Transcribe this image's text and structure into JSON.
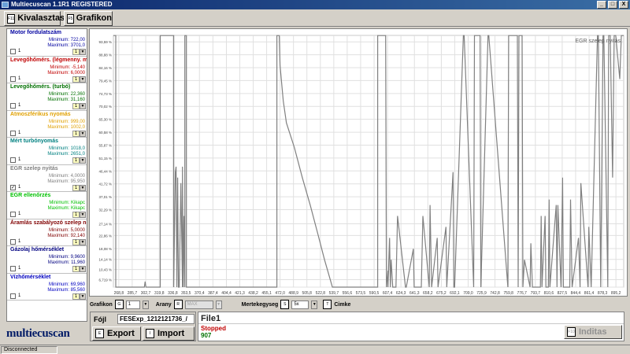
{
  "window": {
    "title": "Multiecuscan 1.1R1 REGISTERED",
    "minimize": "_",
    "maximize": "□",
    "close": "X"
  },
  "tabs": [
    {
      "key": "F11",
      "label": "Kivalasztas"
    },
    {
      "key": "F5",
      "label": "Grafikon"
    }
  ],
  "channels": [
    {
      "name": "Motor fordulatszám",
      "min": "Minimum: 722,00",
      "max": "Maximum: 3701,0",
      "color": "#0000a0",
      "checked": false,
      "index": "1",
      "select": "1"
    },
    {
      "name": "Levegőhőmérs. (légmenny. m",
      "min": "Minimum: -5,140",
      "max": "Maximum: 6,0000",
      "color": "#c00000",
      "checked": false,
      "index": "1",
      "select": "1"
    },
    {
      "name": "Levegőhőmérs. (turbó)",
      "min": "Minimum: 22,360",
      "max": "Maximum: 31,160",
      "color": "#007000",
      "checked": false,
      "index": "1",
      "select": "1"
    },
    {
      "name": "Atmoszférikus nyomás",
      "min": "Minimum: 999,00",
      "max": "Maximum: 1002,0",
      "color": "#e0a000",
      "checked": false,
      "index": "1",
      "select": "1"
    },
    {
      "name": "Mért turbónyomás",
      "min": "Minimum: 1018,0",
      "max": "Maximum: 2651,0",
      "color": "#008080",
      "checked": false,
      "index": "1",
      "select": "1"
    },
    {
      "name": "EGR szelep nyitás",
      "min": "Minimum: 4,0000",
      "max": "Maximum: 95,950",
      "color": "#808080",
      "checked": true,
      "index": "1",
      "select": "1"
    },
    {
      "name": "EGR ellenőrzés",
      "min": "Minimum: Kikapc",
      "max": "Maximum: Kikapc",
      "color": "#00c000",
      "checked": false,
      "index": "1",
      "select": "1"
    },
    {
      "name": "Áramlás szabályozó szelep n",
      "min": "Minimum: 5,0000",
      "max": "Maximum: 92,140",
      "color": "#800000",
      "checked": false,
      "index": "1",
      "select": "1"
    },
    {
      "name": "Gázolaj hőmérséklet",
      "min": "Minimum: 9,9600",
      "max": "Maximum: 11,960",
      "color": "#000080",
      "checked": false,
      "index": "1",
      "select": "1"
    },
    {
      "name": "Vízhőmérséklet",
      "min": "Minimum: 69,960",
      "max": "Maximum: 85,560",
      "color": "#0000c0",
      "checked": false,
      "index": "1",
      "select": "1"
    }
  ],
  "logo": "multiecuscan",
  "controls": {
    "grafikon_label": "Grafikon",
    "grafikon_key": "G",
    "grafikon_value": "1",
    "arany_label": "Arany",
    "arany_key": "R",
    "arany_value": "MAX",
    "mertekegyseg_label": "Mertekegyseg",
    "mertekegyseg_key": "S",
    "mertekegyseg_value": "5x",
    "cimke_key": "T",
    "cimke_label": "Cimke"
  },
  "file": {
    "label": "Fójl",
    "select_value": "FESExp_1212121736_/"
  },
  "buttons": {
    "export_key": "E",
    "export": "Export",
    "import_key": "I",
    "import": "Import",
    "inditas_key": "F10",
    "inditas": "Inditas"
  },
  "filepanel": {
    "name": "File1",
    "status": "Stopped",
    "count": "907"
  },
  "statusbar": {
    "connection": "Disconnected"
  },
  "chart_data": {
    "type": "line",
    "title": "EGR szelep nyitás",
    "series_color": "#808080",
    "ylim": [
      4.0,
      95.95
    ],
    "yticks": [
      4.0,
      6.719,
      10.43,
      14.14,
      18.08,
      22.86,
      27.14,
      32.29,
      37.01,
      41.72,
      46.44,
      51.15,
      55.87,
      60.58,
      65.3,
      70.02,
      74.73,
      79.45,
      84.16,
      88.88,
      93.59
    ],
    "ytick_labels": [
      "",
      "6,719 %",
      "10,43 %",
      "14,14 %",
      "18,08 %",
      "22,86 %",
      "27,14 %",
      "32,29 %",
      "37,01 %",
      "41,72 %",
      "46,44 %",
      "51,15 %",
      "55,87 %",
      "60,58 %",
      "65,30 %",
      "70,02 %",
      "74,73 %",
      "79,45 %",
      "84,16 %",
      "88,88 %",
      "93,59 %"
    ],
    "xlim": [
      262,
      905
    ],
    "xticks": [
      268.8,
      285.7,
      302.7,
      319.8,
      336.8,
      353.5,
      370.4,
      387.4,
      404.4,
      421.3,
      438.2,
      455.1,
      472.0,
      488.9,
      505.8,
      522.8,
      539.7,
      556.6,
      573.5,
      590.5,
      607.4,
      624.3,
      641.3,
      658.2,
      675.2,
      692.1,
      709.0,
      725.9,
      742.8,
      759.8,
      776.7,
      793.7,
      810.6,
      827.5,
      844.4,
      861.4,
      878.3,
      895.2
    ],
    "xtick_labels": [
      "268,8",
      "285,7",
      "302,7",
      "319,8",
      "336,8",
      "353,5",
      "370,4",
      "387,4",
      "404,4",
      "421,3",
      "438,2",
      "455,1",
      "472,0",
      "488,9",
      "505,8",
      "522,8",
      "539,7",
      "556,6",
      "573,5",
      "590,5",
      "607,4",
      "624,3",
      "641,3",
      "658,2",
      "675,2",
      "692,1",
      "709,0",
      "725,9",
      "742,8",
      "759,8",
      "776,7",
      "793,7",
      "810,6",
      "827,5",
      "844,4",
      "861,4",
      "878,3",
      "895,2"
    ],
    "grid": true,
    "x": [
      262,
      265,
      265,
      285,
      285,
      301,
      302,
      303,
      321,
      321,
      338,
      338,
      340,
      341,
      342,
      343,
      344,
      345,
      347,
      349,
      349,
      350,
      351,
      352,
      352,
      354,
      354,
      356,
      356,
      468,
      468,
      471,
      472,
      476,
      480,
      490,
      500,
      510,
      520,
      528,
      538,
      539,
      595,
      595,
      605,
      606,
      608,
      608,
      610,
      611,
      612,
      614,
      618,
      620,
      630,
      631,
      640,
      641,
      650,
      652,
      660,
      661,
      663,
      670,
      671,
      681,
      682,
      690,
      691,
      692,
      703,
      704,
      716,
      717,
      724,
      725,
      734,
      735,
      759,
      760,
      771,
      772,
      773,
      777,
      778,
      780,
      787,
      788,
      790,
      800,
      801,
      802,
      806,
      807,
      810,
      811,
      812,
      820,
      821,
      822,
      826,
      828,
      829,
      837,
      838,
      840,
      848,
      850,
      851,
      860,
      861,
      864,
      872,
      873,
      876,
      879,
      880,
      885,
      886,
      888,
      891,
      893,
      895,
      900,
      902,
      904,
      905
    ],
    "y": [
      95.9,
      95.9,
      4,
      4,
      4,
      4,
      6,
      4,
      4,
      95.9,
      95.9,
      4,
      46,
      48,
      4,
      44,
      4,
      4,
      42,
      4,
      48,
      4,
      30,
      4,
      95.9,
      95.9,
      4,
      4,
      4,
      4,
      95.9,
      95.9,
      85,
      72,
      64,
      55,
      44,
      34,
      23,
      14,
      4,
      4,
      4,
      95.9,
      95.9,
      4,
      10,
      4,
      22,
      4,
      14,
      4,
      4,
      30,
      4,
      4,
      18,
      4,
      4,
      30,
      4,
      34,
      4,
      22,
      4,
      26,
      4,
      46,
      4,
      4,
      95.9,
      95.9,
      4,
      95.9,
      95.9,
      4,
      95.9,
      95.9,
      4,
      95.9,
      95.9,
      4,
      95.9,
      95.9,
      4,
      14,
      4,
      20,
      4,
      4,
      30,
      4,
      30,
      4,
      4,
      36,
      4,
      34,
      4,
      34,
      4,
      44,
      4,
      4,
      36,
      4,
      22,
      4,
      42,
      4,
      26,
      4,
      95.9,
      95.9,
      4,
      95.9,
      95.9,
      4,
      95.9,
      95.9,
      44,
      95.9,
      95.9,
      80,
      95.9,
      95.9,
      95.9
    ]
  }
}
